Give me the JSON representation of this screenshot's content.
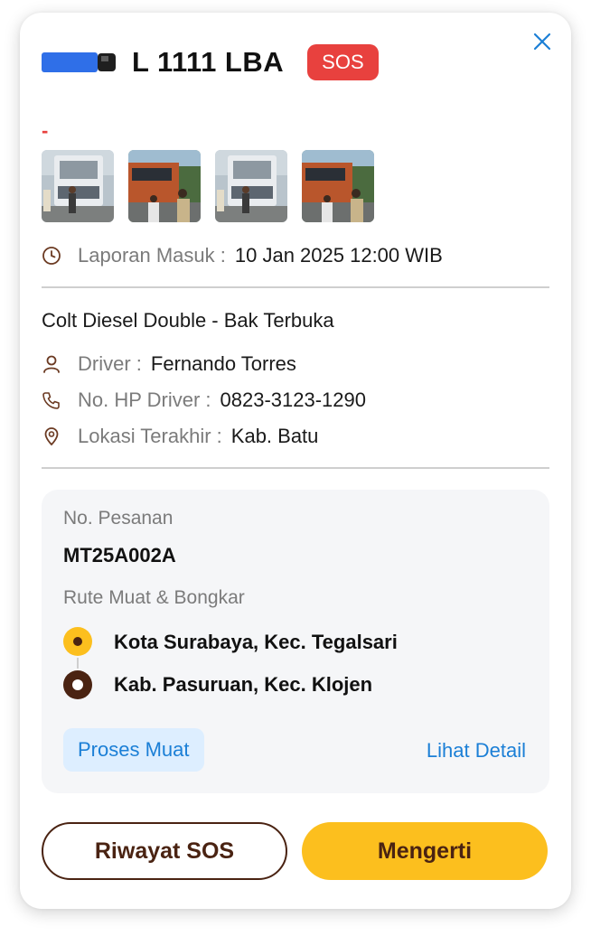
{
  "header": {
    "plate": "L 1111 LBA",
    "sos_badge": "SOS",
    "close_icon": "close-icon",
    "truck_icon": "truck-icon",
    "sub_status": "-"
  },
  "photos": [
    "truck-photo-1",
    "roadside-photo-2",
    "truck-photo-3",
    "roadside-photo-4"
  ],
  "report": {
    "label": "Laporan Masuk :",
    "value": "10 Jan 2025 12:00 WIB"
  },
  "vehicle": {
    "type": "Colt Diesel Double - Bak Terbuka",
    "driver_label": "Driver :",
    "driver_value": "Fernando Torres",
    "phone_label": "No. HP Driver :",
    "phone_value": "0823-3123-1290",
    "location_label": "Lokasi Terakhir :",
    "location_value": "Kab. Batu"
  },
  "order": {
    "number_label": "No. Pesanan",
    "number_value": "MT25A002A",
    "route_label": "Rute Muat & Bongkar",
    "origin": "Kota Surabaya, Kec. Tegalsari",
    "destination": "Kab. Pasuruan, Kec. Klojen",
    "status_pill": "Proses Muat",
    "detail_link": "Lihat Detail"
  },
  "actions": {
    "history_button": "Riwayat SOS",
    "confirm_button": "Mengerti"
  },
  "colors": {
    "sos_red": "#e8413e",
    "primary_yellow": "#fcbf1e",
    "brown": "#4a2312",
    "link_blue": "#1b7fd6",
    "pill_bg": "#ddeeff"
  }
}
